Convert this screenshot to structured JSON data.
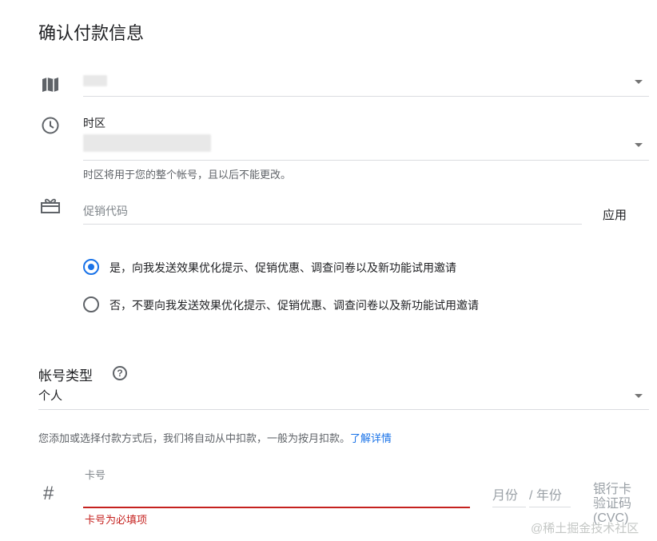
{
  "page": {
    "title": "确认付款信息"
  },
  "location": {
    "icon": "map-icon"
  },
  "timezone": {
    "icon": "clock-icon",
    "label": "时区",
    "hint": "时区将用于您的整个帐号，且以后不能更改。"
  },
  "promo": {
    "icon": "gift-icon",
    "placeholder": "促销代码",
    "apply_label": "应用"
  },
  "email_opt": {
    "selected": "yes",
    "options": [
      {
        "id": "yes",
        "label": "是，向我发送效果优化提示、促销优惠、调查问卷以及新功能试用邀请"
      },
      {
        "id": "no",
        "label": "否，不要向我发送效果优化提示、促销优惠、调查问卷以及新功能试用邀请"
      }
    ]
  },
  "account_type": {
    "label": "帐号类型",
    "help_icon": "help-icon",
    "value": "个人"
  },
  "billing_info": {
    "text": "您添加或选择付款方式后，我们将自动从中扣款，一般为按月扣款。",
    "link": "了解详情"
  },
  "card": {
    "icon": "hash-icon",
    "icon_glyph": "#",
    "number_label": "卡号",
    "error": "卡号为必填项",
    "month_label": "月份",
    "year_label": "/ 年份",
    "cvc_label_line1": "银行卡",
    "cvc_label_line2": "验证码",
    "cvc_label_line3": "(CVC)"
  },
  "watermark": "@稀土掘金技术社区",
  "colors": {
    "accent": "#1a73e8",
    "error": "#c5221f",
    "divider": "#dadce0",
    "icon": "#5f6368"
  }
}
